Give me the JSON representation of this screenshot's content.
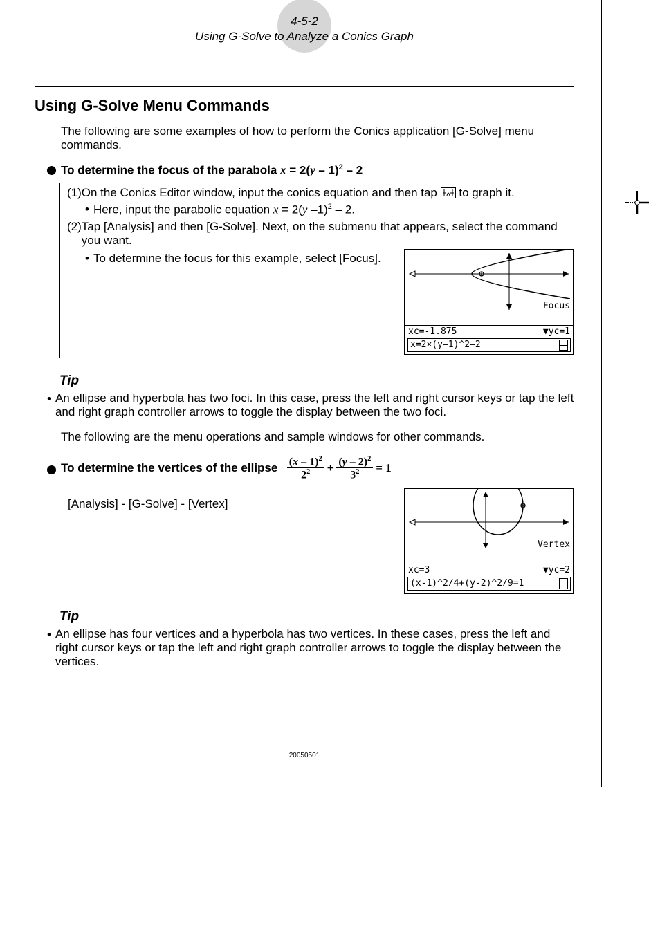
{
  "header": {
    "page_number": "4-5-2",
    "title": "Using G-Solve to Analyze a Conics Graph"
  },
  "section_heading": "Using G-Solve Menu Commands",
  "intro": "The following are some examples of how to perform the Conics application [G-Solve] menu commands.",
  "task1": {
    "lead": "To determine the focus of the parabola ",
    "eq_lhs": "x",
    "eq_rhs_a": " = 2(",
    "eq_rhs_y": "y",
    "eq_rhs_b": " – 1)",
    "eq_rhs_exp": "2",
    "eq_rhs_c": " – 2",
    "step1_num": "(1) ",
    "step1_text": "On the Conics Editor window, input the conics equation and then tap ",
    "step1_tail": " to graph it.",
    "step1_sub_a": "Here, input the parabolic equation ",
    "step1_sub_eq_x": "x",
    "step1_sub_eq_m": " = 2(",
    "step1_sub_eq_y": "y",
    "step1_sub_eq_t": " –1)",
    "step1_sub_eq_e": "2",
    "step1_sub_eq_end": " – 2.",
    "step2_num": "(2) ",
    "step2_text": "Tap [Analysis] and then [G-Solve]. Next, on the submenu that appears, select the command you want.",
    "step2_sub": "To determine the focus for this example, select [Focus]."
  },
  "calc1": {
    "label": "Focus",
    "xc": "xc=-1.875",
    "yc": "yc=1",
    "expr": "x=2×(y–1)^2–2"
  },
  "tip1": {
    "heading": "Tip",
    "body": "An ellipse and hyperbola has two foci. In this case, press the left and right cursor keys or tap the left and right graph controller arrows to toggle the display between the two foci."
  },
  "mid_para": "The following are the menu operations and sample windows for other commands.",
  "task2": {
    "lead": "To determine the vertices of the ellipse ",
    "frac1_num_a": "(",
    "frac1_num_x": "x",
    "frac1_num_b": " – 1)",
    "frac1_num_e": "2",
    "frac1_den_b": "2",
    "frac1_den_e": "2",
    "plus": " + ",
    "frac2_num_a": "(",
    "frac2_num_y": "y",
    "frac2_num_b": " – 2)",
    "frac2_num_e": "2",
    "frac2_den_b": "3",
    "frac2_den_e": "2",
    "eq_tail": " = 1",
    "menu_path": "[Analysis] - [G-Solve] - [Vertex]"
  },
  "calc2": {
    "label": "Vertex",
    "xc": "xc=3",
    "yc": "yc=2",
    "expr": "(x-1)^2/4+(y-2)^2/9=1"
  },
  "tip2": {
    "heading": "Tip",
    "body": "An ellipse has four vertices and a hyperbola has two vertices. In these cases, press the left and right cursor keys or tap the left and right graph controller arrows to toggle the display between the vertices."
  },
  "footer_code": "20050501"
}
